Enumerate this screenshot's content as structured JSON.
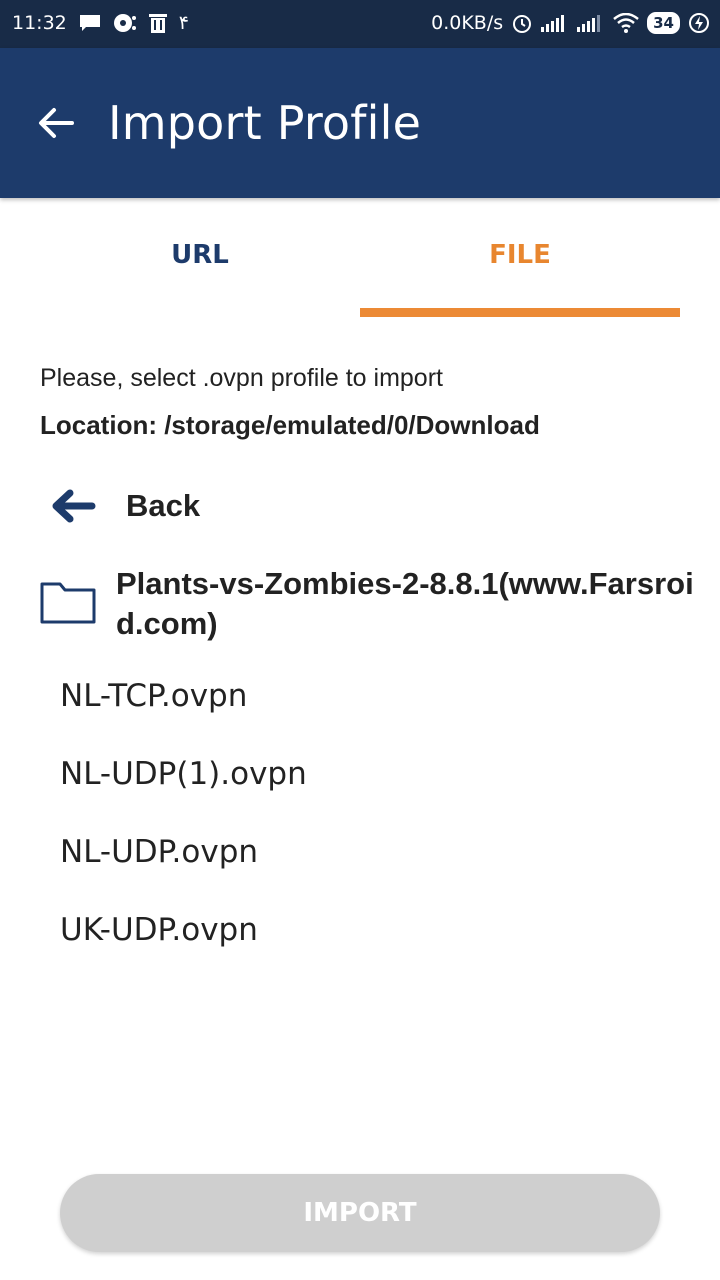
{
  "status_bar": {
    "time": "11:32",
    "notification_count": "۴",
    "network_speed": "0.0KB/s",
    "battery": "34",
    "icons": [
      "message-icon",
      "media-icon",
      "delete-icon",
      "alarm-icon",
      "signal-icon",
      "signal-icon",
      "wifi-icon",
      "battery-icon",
      "charging-icon"
    ]
  },
  "app_bar": {
    "title": "Import Profile",
    "back_icon": "arrow-left-icon",
    "background": "#1d3b6b"
  },
  "tabs": [
    {
      "label": "URL",
      "selected": false
    },
    {
      "label": "FILE",
      "selected": true
    }
  ],
  "accent_color": "#ec8a35",
  "content": {
    "prompt": "Please, select .ovpn profile to import",
    "location": "Location: /storage/emulated/0/Download",
    "back_label": "Back",
    "folder_name": "Plants-vs-Zombies-2-8.8.1(www.Farsroid.com)",
    "files": [
      "NL-TCP.ovpn",
      "NL-UDP(1).ovpn",
      "NL-UDP.ovpn",
      "UK-UDP.ovpn"
    ]
  },
  "import_button": {
    "label": "IMPORT",
    "enabled": false
  }
}
